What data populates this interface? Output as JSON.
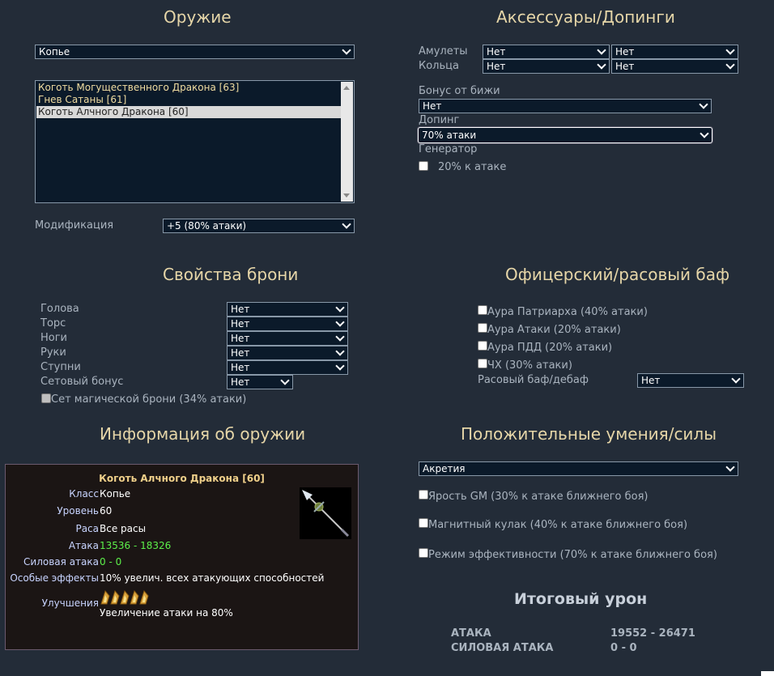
{
  "weapon": {
    "heading": "Оружие",
    "type_value": "Копье",
    "list": [
      "Коготь Могущественного Дракона [63]",
      "Гнев Сатаны [61]",
      "Коготь Алчного Дракона [60]"
    ],
    "mod_label": "Модификация",
    "mod_value": "+5 (80% атаки)"
  },
  "acc": {
    "heading": "Аксессуары/Допинги",
    "amulets_label": "Амулеты",
    "amulet1": "Нет",
    "amulet2": "Нет",
    "rings_label": "Кольца",
    "ring1": "Нет",
    "ring2": "Нет",
    "jewel_label": "Бонус от бижи",
    "jewel_value": "Нет",
    "doping_label": "Допинг",
    "doping_value": "70% атаки",
    "gen_label": "Генератор",
    "gen_checkbox": "20% к атаке"
  },
  "armor": {
    "heading": "Свойства брони",
    "rows": [
      {
        "label": "Голова",
        "value": "Нет"
      },
      {
        "label": "Торс",
        "value": "Нет"
      },
      {
        "label": "Ноги",
        "value": "Нет"
      },
      {
        "label": "Руки",
        "value": "Нет"
      },
      {
        "label": "Ступни",
        "value": "Нет"
      },
      {
        "label": "Сетовый бонус",
        "value": "Нет"
      }
    ],
    "magic_set": "Сет магической брони (34% атаки)"
  },
  "officer": {
    "heading": "Офицерский/расовый баф",
    "checks": [
      "Аура Патриарха (40% атаки)",
      "Аура Атаки (20% атаки)",
      "Аура ПДД (20% атаки)",
      "ЧХ (30% атаки)"
    ],
    "race_label": "Расовый баф/дебаф",
    "race_value": "Нет"
  },
  "info": {
    "heading": "Информация об оружии",
    "title": "Коготь Алчного Дракона [60]",
    "rows": [
      {
        "key": "Класс",
        "value": "Копье"
      },
      {
        "key": "Уровень",
        "value": "60"
      },
      {
        "key": "Раса",
        "value": "Все расы"
      },
      {
        "key": "Атака",
        "value": "13536 - 18326"
      },
      {
        "key": "Силовая атака",
        "value": "0 - 0"
      },
      {
        "key": "Особые эффекты",
        "value": "10% увелич. всех атакующих способностей"
      },
      {
        "key": "Улучшения",
        "value": ""
      }
    ],
    "upgrade_text": "Увеличение атаки на 80%",
    "upgrade_level": 5,
    "accent_green": "#5df04a",
    "accent_gold": "#f0d08a"
  },
  "skills": {
    "heading": "Положительные умения/силы",
    "select_value": "Акретия",
    "checks": [
      "Ярость GM (30% к атаке ближнего боя)",
      "Магнитный кулак (40% к атаке ближнего боя)",
      "Режим эффективности (70% к атаке ближнего боя)"
    ]
  },
  "total": {
    "heading": "Итоговый урон",
    "attack_label": "АТАКА",
    "attack_value": "19552 - 26471",
    "power_label": "СИЛОВАЯ АТАКА",
    "power_value": "0 - 0"
  },
  "colors": {
    "background": "#232c38",
    "heading": "#e6d6a8",
    "select_bg": "#0b1a2a"
  }
}
